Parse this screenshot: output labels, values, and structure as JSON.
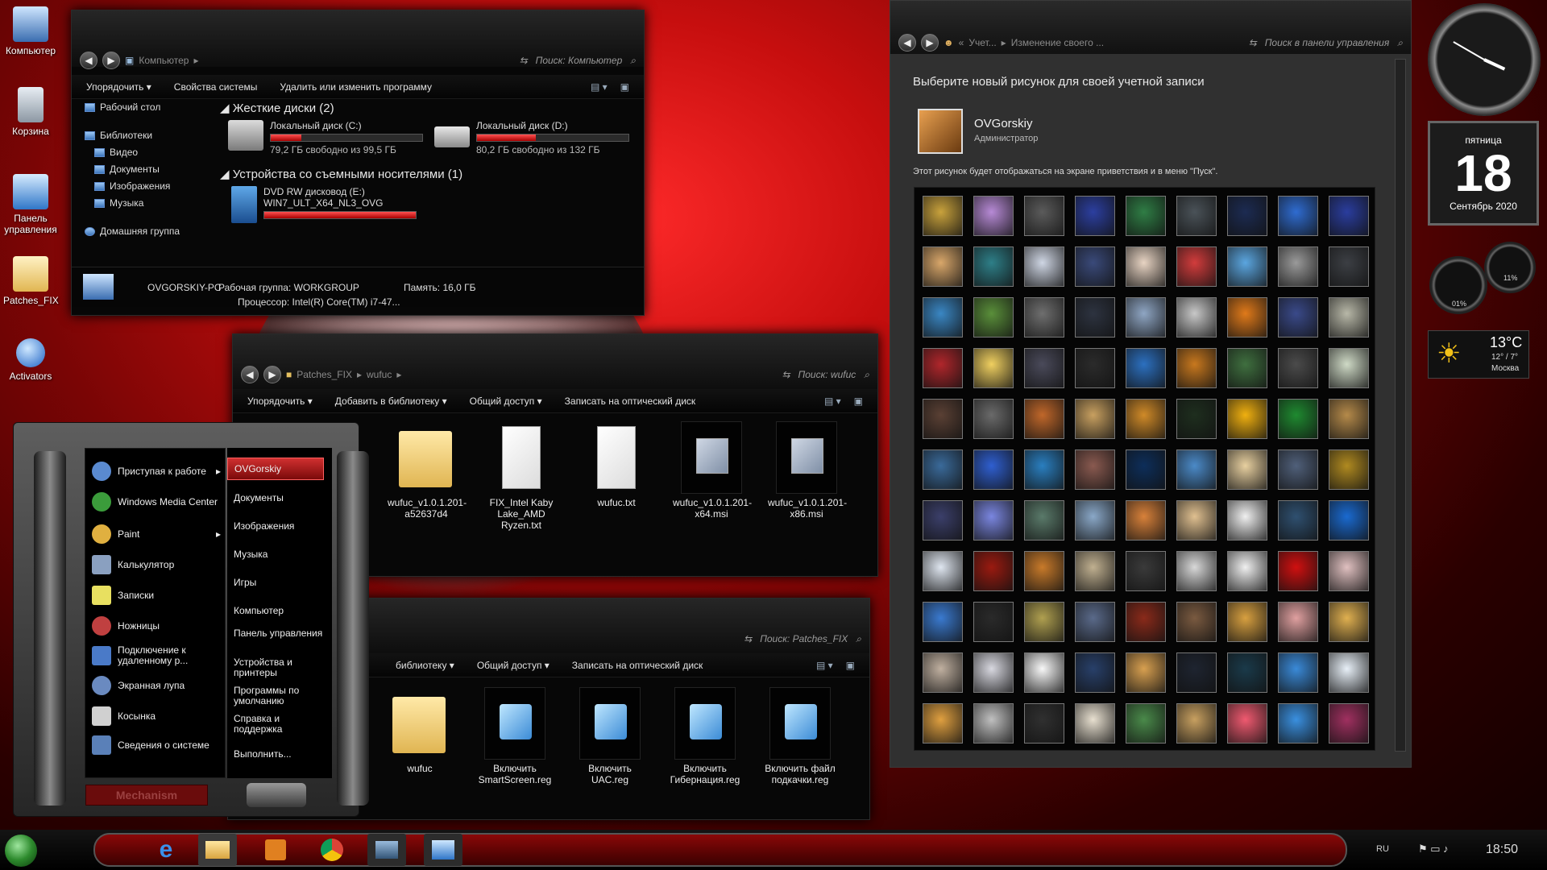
{
  "desktop": {
    "icons": [
      {
        "label": "Компьютер"
      },
      {
        "label": "Корзина"
      },
      {
        "label": "Панель управления"
      },
      {
        "label": "Patches_FIX"
      },
      {
        "label": "Activators"
      }
    ]
  },
  "computer_window": {
    "breadcrumb": "Компьютер",
    "search_placeholder": "Поиск: Компьютер",
    "toolbar": [
      "Упорядочить",
      "Свойства системы",
      "Удалить или изменить программу"
    ],
    "nav": [
      "Рабочий стол",
      "Библиотеки",
      "Видео",
      "Документы",
      "Изображения",
      "Музыка",
      "Домашняя группа"
    ],
    "hdd_header": "Жесткие диски (2)",
    "drives": [
      {
        "name": "Локальный диск (C:)",
        "free": "79,2 ГБ свободно из 99,5 ГБ",
        "used_fraction": 0.2
      },
      {
        "name": "Локальный диск (D:)",
        "free": "80,2 ГБ свободно из 132 ГБ",
        "used_fraction": 0.39
      }
    ],
    "removable_header": "Устройства со съемными носителями (1)",
    "dvd": {
      "name": "DVD RW дисковод (E:)",
      "label": "WIN7_ULT_X64_NL3_OVG",
      "used_fraction": 1.0
    },
    "details": {
      "pc": "OVGORSKIY-PC",
      "workgroup": "Рабочая группа: WORKGROUP",
      "memory": "Память: 16,0 ГБ",
      "cpu": "Процессор: Intel(R) Core(TM) i7-47..."
    }
  },
  "wufuc_window": {
    "path": [
      "Patches_FIX",
      "wufuc"
    ],
    "search_placeholder": "Поиск: wufuc",
    "toolbar": [
      "Упорядочить",
      "Добавить в библиотеку",
      "Общий доступ",
      "Записать на оптический диск"
    ],
    "files": [
      {
        "name": "wufuc_v1.0.1.201-a52637d4",
        "kind": "folder"
      },
      {
        "name": "FIX_Intel Kaby Lake_AMD Ryzen.txt",
        "kind": "doc"
      },
      {
        "name": "wufuc.txt",
        "kind": "doc"
      },
      {
        "name": "wufuc_v1.0.1.201-x64.msi",
        "kind": "msi"
      },
      {
        "name": "wufuc_v1.0.1.201-x86.msi",
        "kind": "msi"
      }
    ]
  },
  "patches_window": {
    "search_placeholder": "Поиск: Patches_FIX",
    "toolbar": [
      "библиотеку",
      "Общий доступ",
      "Записать на оптический диск"
    ],
    "files": [
      {
        "name": "wufuc",
        "kind": "folder"
      },
      {
        "name": "Включить SmartScreen.reg",
        "kind": "reg"
      },
      {
        "name": "Включить UAC.reg",
        "kind": "reg"
      },
      {
        "name": "Включить Гибернация.reg",
        "kind": "reg"
      },
      {
        "name": "Включить файл подкачки.reg",
        "kind": "reg"
      }
    ]
  },
  "start_menu": {
    "programs": [
      "Приступая к работе",
      "Windows Media Center",
      "Paint",
      "Калькулятор",
      "Записки",
      "Ножницы",
      "Подключение к удаленному р...",
      "Экранная лупа",
      "Косынка",
      "Сведения о системе"
    ],
    "user": "OVGorskiy",
    "places": [
      "Документы",
      "Изображения",
      "Музыка",
      "Игры",
      "Компьютер",
      "Панель управления",
      "Устройства и принтеры",
      "Программы по умолчанию",
      "Справка и поддержка",
      "Выполнить..."
    ],
    "theme_label": "Mechanism"
  },
  "control_panel": {
    "breadcrumb": [
      "Учет...",
      "Изменение своего ..."
    ],
    "search_placeholder": "Поиск в панели управления",
    "heading": "Выберите новый рисунок для своей учетной записи",
    "user_name": "OVGorskiy",
    "user_role": "Администратор",
    "note": "Этот рисунок будет отображаться на экране приветствия и в меню \"Пуск\".",
    "avatar_colors": [
      "#c9a23c",
      "#b78ad6",
      "#5b5b5b",
      "#2c3fa0",
      "#2f7d45",
      "#4a5258",
      "#1c2b52",
      "#2f6cd1",
      "#2a3d9e",
      "#d9a76a",
      "#2e7f88",
      "#cfd6e4",
      "#3a4a7a",
      "#e8d4c3",
      "#d23c3c",
      "#5ba6e0",
      "#9a9a9a",
      "#3c3f44",
      "#3a87c4",
      "#5a8f3a",
      "#6f6f6f",
      "#2d3340",
      "#8fa6c4",
      "#c8c8c8",
      "#e07a1a",
      "#3a4a8a",
      "#b8b8a8",
      "#b0262b",
      "#f0d060",
      "#4a4a5a",
      "#2b2b2b",
      "#2c70c0",
      "#c8781e",
      "#3f6f3f",
      "#4b4b4b",
      "#cfdac6",
      "#5a4034",
      "#6a6a6a",
      "#c0672a",
      "#c8a060",
      "#d08a28",
      "#1e2e1e",
      "#f0b010",
      "#1f8a30",
      "#b58a4a",
      "#3a6a9a",
      "#2f5fd0",
      "#2a7fc0",
      "#8a5a50",
      "#0d2e5a",
      "#4b8ac8",
      "#e8d0a0",
      "#50607a",
      "#b08a20",
      "#3b3f6a",
      "#7a86e0",
      "#5a7a6a",
      "#8aa8c8",
      "#d8813a",
      "#e0c090",
      "#f0f0f0",
      "#2f5070",
      "#1a6ad0",
      "#dfe6f0",
      "#9a1a10",
      "#c87a2a",
      "#c0b090",
      "#3a3a3a",
      "#d8d8d8",
      "#f0f0f0",
      "#d01010",
      "#e0c0c0",
      "#3a7ad0",
      "#2a2a2a",
      "#b0a050",
      "#5a6a8a",
      "#8a2a1a",
      "#7a5a40",
      "#d8a040",
      "#e0a0a0",
      "#e0b050",
      "#c0b0a0",
      "#d8d8e0",
      "#f8f8f8",
      "#28406a",
      "#d8a050",
      "#1e2430",
      "#1a3a4a",
      "#3a8ad8",
      "#e8f0f8",
      "#e0a040",
      "#c0c0c0",
      "#303030",
      "#e8e0d0",
      "#4a8a4a",
      "#c8a060",
      "#f05a70",
      "#3a90e0",
      "#a03060"
    ]
  },
  "gadgets": {
    "clock": {
      "hour": 3,
      "minute": 50
    },
    "calendar": {
      "weekday": "пятница",
      "day": "18",
      "month_year": "Сентябрь 2020"
    },
    "meter": {
      "cpu": "01%",
      "mem": "11%"
    },
    "weather": {
      "temp": "13°C",
      "range": "12° / 7°",
      "city": "Москва"
    }
  },
  "taskbar": {
    "lang": "RU",
    "time": "18:50"
  }
}
